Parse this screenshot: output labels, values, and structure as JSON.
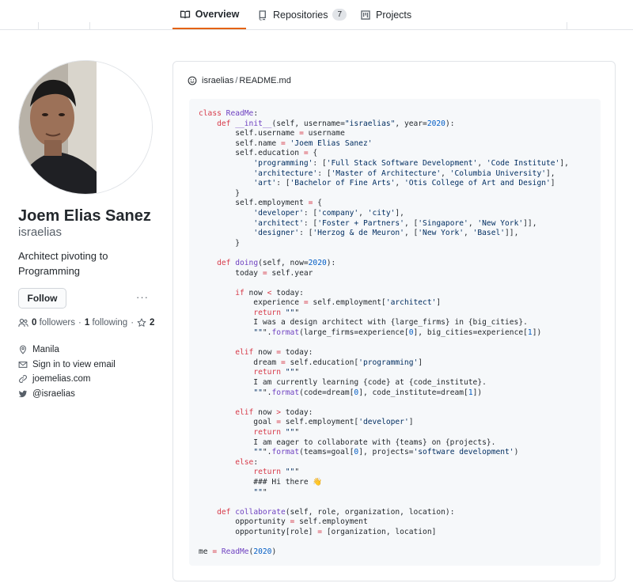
{
  "nav": {
    "tabs": [
      {
        "label": "Overview",
        "icon": "book-icon",
        "active": true
      },
      {
        "label": "Repositories",
        "icon": "repo-icon",
        "count": "7"
      },
      {
        "label": "Projects",
        "icon": "project-icon"
      }
    ]
  },
  "profile": {
    "full_name": "Joem Elias Sanez",
    "username": "israelias",
    "bio": "Architect pivoting to Programming",
    "follow_label": "Follow",
    "more_label": "···",
    "followers_count": "0",
    "followers_label": "followers",
    "following_count": "1",
    "following_label": "following",
    "stars_count": "2",
    "location": "Manila",
    "email": "Sign in to view email",
    "website": "joemelias.com",
    "twitter": "@israelias"
  },
  "readme": {
    "owner": "israelias",
    "separator": "/",
    "file": "README.md",
    "code_lines": [
      "class ReadMe:",
      "    def __init__(self, username=\"israelias\", year=2020):",
      "        self.username = username",
      "        self.name = 'Joem Elias Sanez'",
      "        self.education = {",
      "            'programming': ['Full Stack Software Development', 'Code Institute'],",
      "            'architecture': ['Master of Architecture', 'Columbia University'],",
      "            'art': ['Bachelor of Fine Arts', 'Otis College of Art and Design']",
      "        }",
      "        self.employment = {",
      "            'developer': ['company', 'city'],",
      "            'architect': ['Foster + Partners', ['Singapore', 'New York']],",
      "            'designer': ['Herzog & de Meuron', ['New York', 'Basel']],",
      "        }",
      "",
      "    def doing(self, now=2020):",
      "        today = self.year",
      "",
      "        if now < today:",
      "            experience = self.employment['architect']",
      "            return \"\"\"",
      "            I was a design architect with {large_firms} in {big_cities}.",
      "            \"\"\".format(large_firms=experience[0], big_cities=experience[1])",
      "",
      "        elif now = today:",
      "            dream = self.education['programming']",
      "            return \"\"\"",
      "            I am currently learning {code} at {code_institute}.",
      "            \"\"\".format(code=dream[0], code_institute=dream[1])",
      "",
      "        elif now > today:",
      "            goal = self.employment['developer']",
      "            return \"\"\"",
      "            I am eager to collaborate with {teams} on {projects}.",
      "            \"\"\".format(teams=goal[0], projects='software development')",
      "        else:",
      "            return \"\"\"",
      "            ### Hi there 👋",
      "            \"\"\"",
      "",
      "    def collaborate(self, role, organization, location):",
      "        opportunity = self.employment",
      "        opportunity[role] = [organization, location]",
      "",
      "me = ReadMe(2020)"
    ]
  },
  "colors": {
    "accent": "#e36209",
    "keyword": "#d73a49",
    "function": "#6f42c1",
    "string": "#032f62",
    "number": "#005cc5",
    "muted": "#586069"
  }
}
